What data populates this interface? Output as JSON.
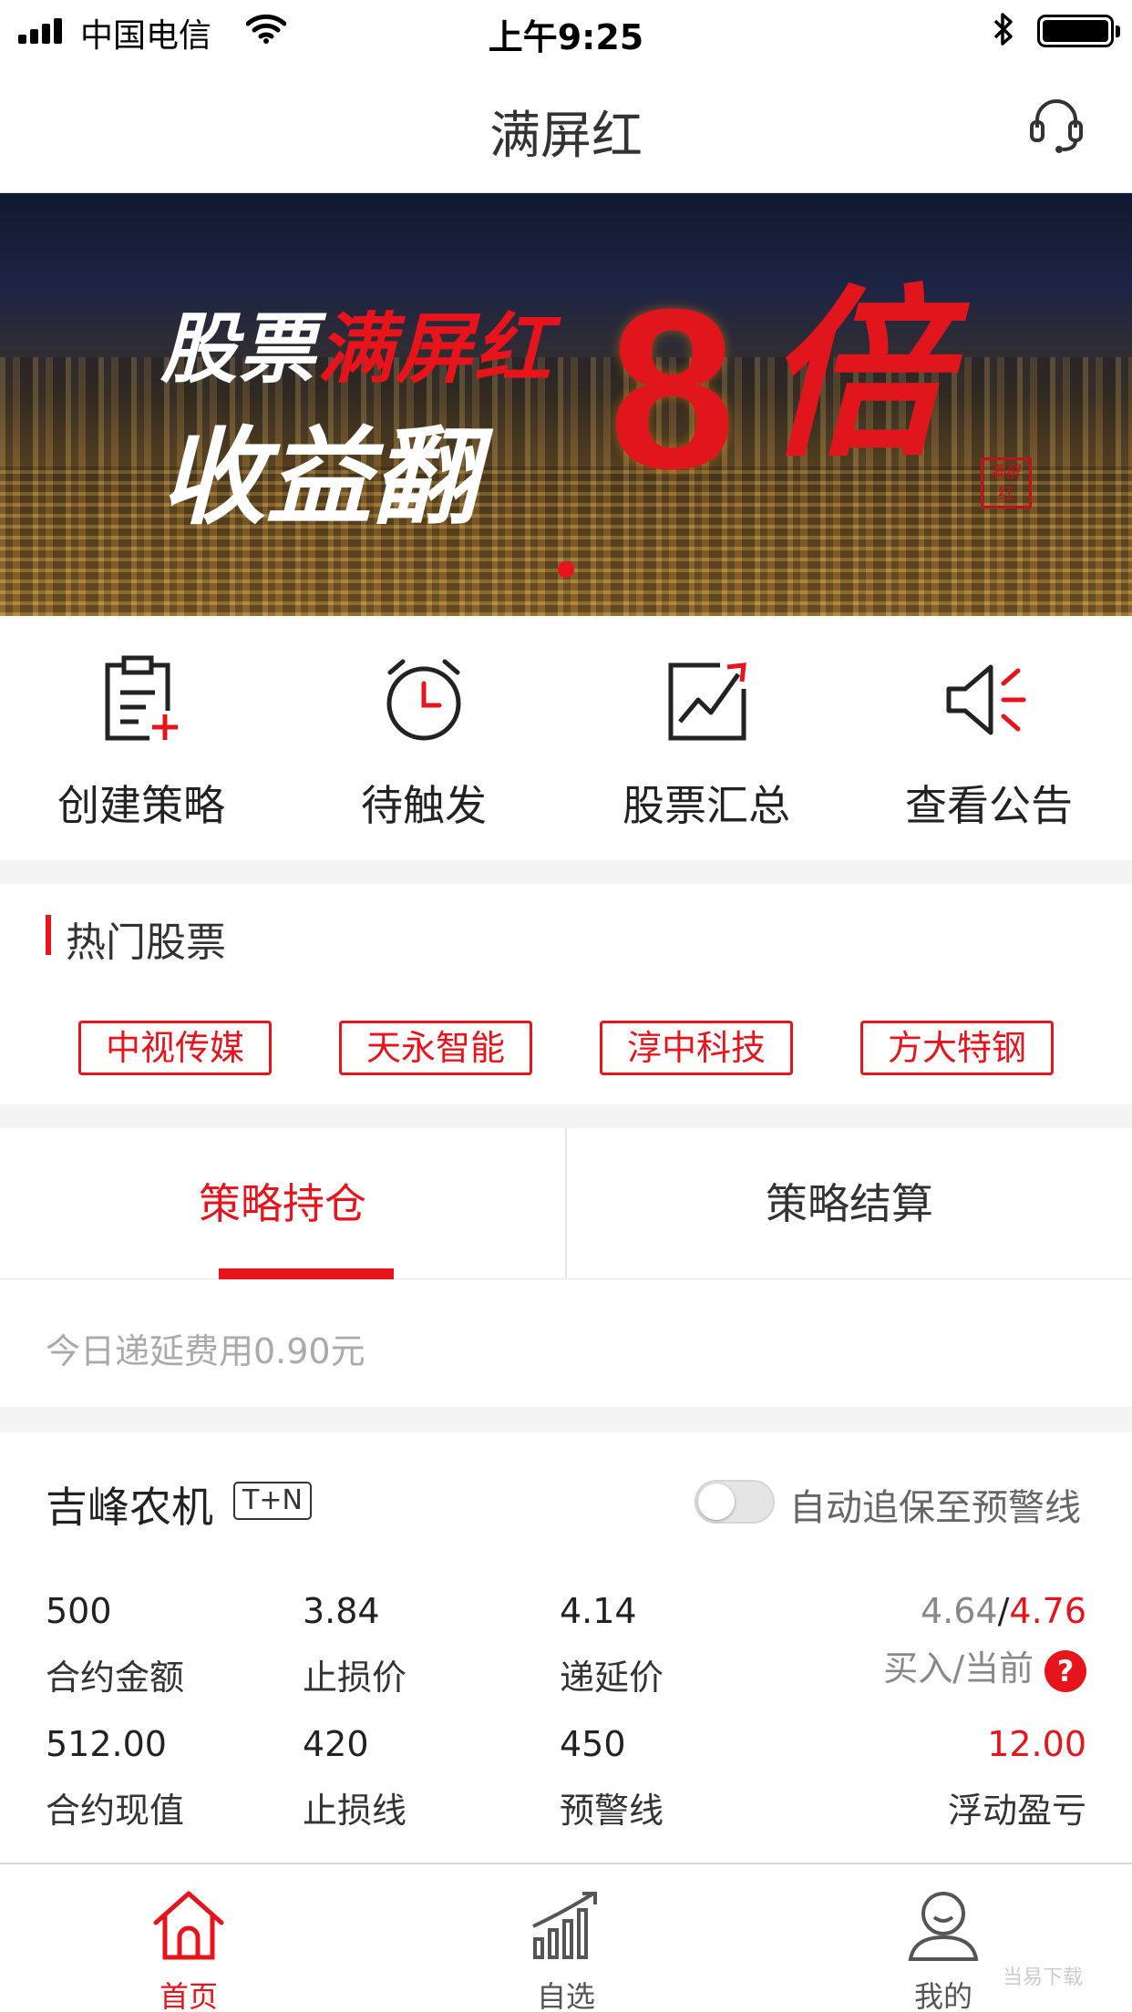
{
  "status_bar": {
    "carrier": "中国电信",
    "time": "上午9:25"
  },
  "nav": {
    "title": "满屏红"
  },
  "banner": {
    "line1_white": "股票",
    "line1_red": "满屏红",
    "line2": "收益翻",
    "big_num": "8",
    "big_char": "倍",
    "seal": "满屏红"
  },
  "quick_menu": [
    {
      "label": "创建策略",
      "icon": "create-strategy-icon"
    },
    {
      "label": "待触发",
      "icon": "alarm-clock-icon"
    },
    {
      "label": "股票汇总",
      "icon": "chart-summary-icon"
    },
    {
      "label": "查看公告",
      "icon": "speaker-icon"
    }
  ],
  "hot_stocks": {
    "title": "热门股票",
    "items": [
      "中视传媒",
      "天永智能",
      "淳中科技",
      "方大特钢"
    ]
  },
  "tabs": {
    "active": "策略持仓",
    "inactive": "策略结算"
  },
  "fee_notice": "今日递延费用0.90元",
  "position": {
    "name": "吉峰农机",
    "tag": "T+N",
    "toggle_label": "自动追保至预警线",
    "toggle_on": false,
    "row1": [
      {
        "value": "500",
        "label": "合约金额"
      },
      {
        "value": "3.84",
        "label": "止损价"
      },
      {
        "value": "4.14",
        "label": "递延价"
      }
    ],
    "buy_price": "4.64",
    "current_price": "4.76",
    "price_separator": "/",
    "price_label": "买入/当前",
    "help_glyph": "?",
    "row2": [
      {
        "value": "512.00",
        "label": "合约现值"
      },
      {
        "value": "420",
        "label": "止损线"
      },
      {
        "value": "450",
        "label": "预警线"
      }
    ],
    "pnl_value": "12.00",
    "pnl_label": "浮动盈亏"
  },
  "tabbar": [
    {
      "label": "首页",
      "icon": "home-icon",
      "active": true
    },
    {
      "label": "自选",
      "icon": "watchlist-icon",
      "active": false
    },
    {
      "label": "我的",
      "icon": "profile-icon",
      "active": false
    }
  ],
  "watermark": "当易下载",
  "colors": {
    "accent": "#e8141c",
    "text": "#222222",
    "muted": "#aaaaaa"
  }
}
